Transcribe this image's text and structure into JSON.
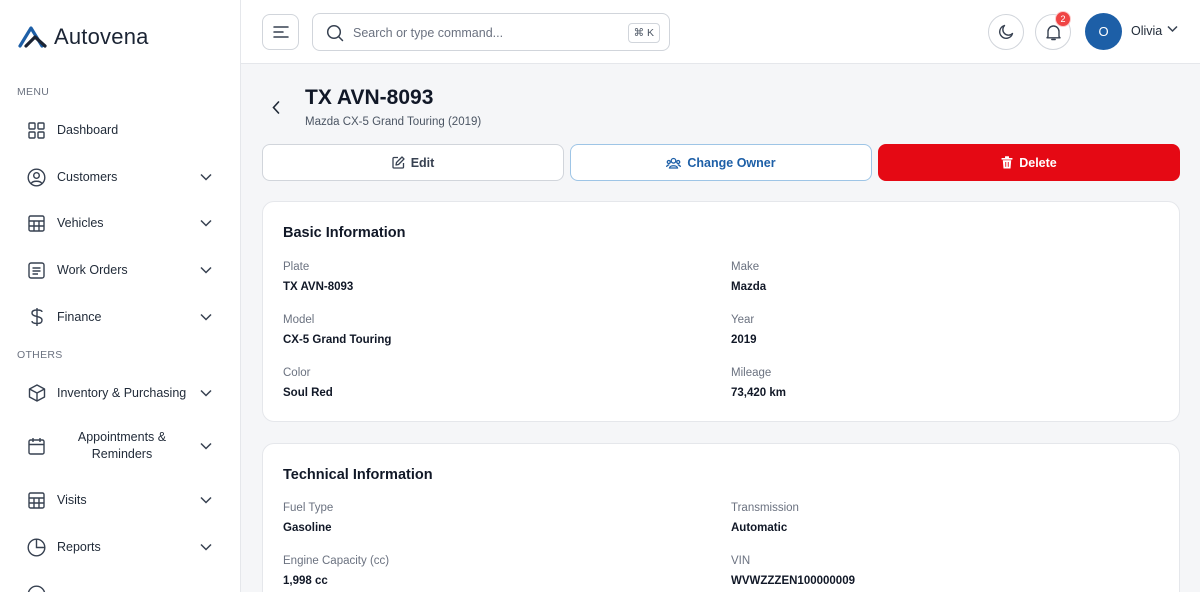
{
  "app": {
    "name": "Autovena"
  },
  "sidebar": {
    "menu_label": "MENU",
    "others_label": "OTHERS",
    "items": [
      {
        "label": "Dashboard",
        "icon": "grid-icon",
        "expandable": false
      },
      {
        "label": "Customers",
        "icon": "user-circle-icon",
        "expandable": true
      },
      {
        "label": "Vehicles",
        "icon": "table-icon",
        "expandable": true
      },
      {
        "label": "Work Orders",
        "icon": "document-icon",
        "expandable": true
      },
      {
        "label": "Finance",
        "icon": "dollar-icon",
        "expandable": true
      }
    ],
    "other_items": [
      {
        "label": "Inventory & Purchasing",
        "icon": "box-icon",
        "expandable": true
      },
      {
        "label": "Appointments & Reminders",
        "icon": "calendar-icon",
        "expandable": true
      },
      {
        "label": "Visits",
        "icon": "table-icon",
        "expandable": true
      },
      {
        "label": "Reports",
        "icon": "pie-chart-icon",
        "expandable": true
      }
    ]
  },
  "topbar": {
    "search_placeholder": "Search or type command...",
    "shortcut": "⌘ K",
    "notification_count": "2",
    "user_initial": "O",
    "user_name": "Olivia"
  },
  "vehicle": {
    "title": "TX AVN-8093",
    "subtitle": "Mazda CX-5 Grand Touring (2019)"
  },
  "actions": {
    "edit": "Edit",
    "change_owner": "Change Owner",
    "delete": "Delete"
  },
  "basic": {
    "title": "Basic Information",
    "fields": [
      {
        "label": "Plate",
        "value": "TX AVN-8093"
      },
      {
        "label": "Make",
        "value": "Mazda"
      },
      {
        "label": "Model",
        "value": "CX-5 Grand Touring"
      },
      {
        "label": "Year",
        "value": "2019"
      },
      {
        "label": "Color",
        "value": "Soul Red"
      },
      {
        "label": "Mileage",
        "value": "73,420 km"
      }
    ]
  },
  "technical": {
    "title": "Technical Information",
    "fields": [
      {
        "label": "Fuel Type",
        "value": "Gasoline"
      },
      {
        "label": "Transmission",
        "value": "Automatic"
      },
      {
        "label": "Engine Capacity (cc)",
        "value": "1,998 cc"
      },
      {
        "label": "VIN",
        "value": "WVWZZZEN100000009"
      }
    ]
  },
  "colors": {
    "primary": "#1d5fa7",
    "danger": "#e50914",
    "badge": "#ef4444"
  }
}
